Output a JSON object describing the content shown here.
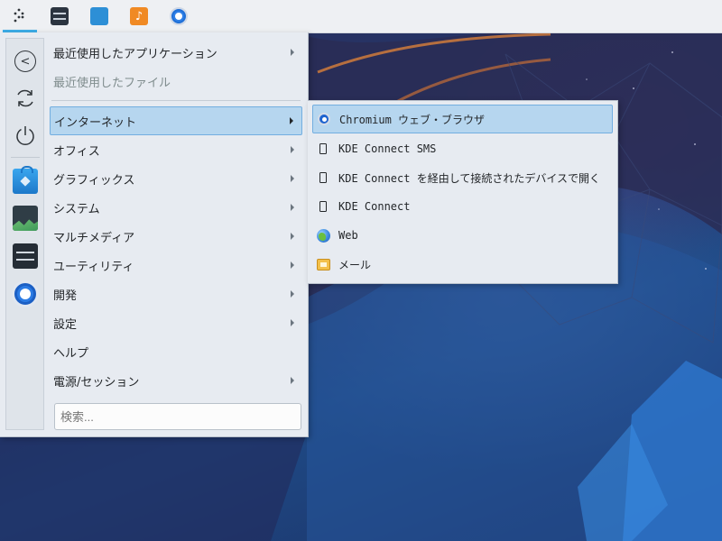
{
  "panel": {
    "tasks": [
      {
        "name": "application-launcher",
        "icon": "kde-launcher-icon"
      },
      {
        "name": "system-monitor",
        "icon": "system-monitor-icon"
      },
      {
        "name": "discover",
        "icon": "software-store-icon"
      },
      {
        "name": "music-player",
        "icon": "music-icon"
      },
      {
        "name": "chromium",
        "icon": "chromium-icon"
      }
    ]
  },
  "menu": {
    "sidebar": [
      {
        "name": "back",
        "icon": "back-arrow-icon"
      },
      {
        "name": "restart",
        "icon": "restart-icon"
      },
      {
        "name": "shutdown",
        "icon": "power-icon"
      },
      {
        "name": "discover",
        "icon": "software-store-icon"
      },
      {
        "name": "system-monitor",
        "icon": "system-activity-icon"
      },
      {
        "name": "system-settings",
        "icon": "settings-panel-icon"
      },
      {
        "name": "chromium",
        "icon": "chromium-icon"
      }
    ],
    "recent_apps": "最近使用したアプリケーション",
    "recent_files": "最近使用したファイル",
    "categories": [
      {
        "label": "インターネット",
        "has_submenu": true,
        "active": true
      },
      {
        "label": "オフィス",
        "has_submenu": true
      },
      {
        "label": "グラフィックス",
        "has_submenu": true
      },
      {
        "label": "システム",
        "has_submenu": true
      },
      {
        "label": "マルチメディア",
        "has_submenu": true
      },
      {
        "label": "ユーティリティ",
        "has_submenu": true
      },
      {
        "label": "開発",
        "has_submenu": true
      },
      {
        "label": "設定",
        "has_submenu": true
      },
      {
        "label": "ヘルプ",
        "has_submenu": false
      },
      {
        "label": "電源/セッション",
        "has_submenu": true
      }
    ],
    "search_placeholder": "検索..."
  },
  "submenu": {
    "items": [
      {
        "label": "Chromium ウェブ・ブラウザ",
        "icon": "chromium-icon",
        "active": true
      },
      {
        "label": "KDE Connect SMS",
        "icon": "phone-icon"
      },
      {
        "label": "KDE Connect を経由して接続されたデバイスで開く",
        "icon": "phone-icon"
      },
      {
        "label": "KDE Connect",
        "icon": "phone-icon"
      },
      {
        "label": "Web",
        "icon": "globe-icon"
      },
      {
        "label": "メール",
        "icon": "mail-icon"
      }
    ]
  },
  "colors": {
    "highlight": "#b6d6ef",
    "highlight_border": "#72aee0",
    "accent": "#3daee9",
    "menu_bg": "#e7ebf1"
  }
}
